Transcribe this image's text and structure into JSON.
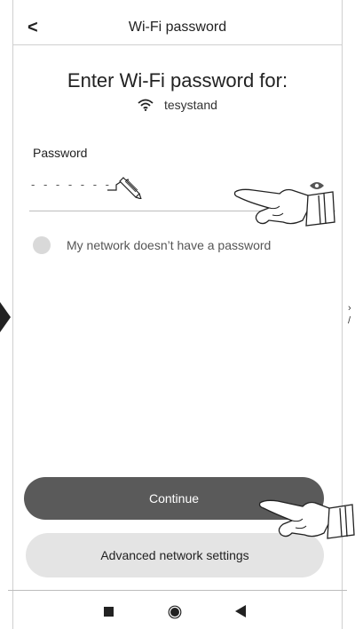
{
  "header": {
    "back_glyph": "<",
    "title": "Wi-Fi password"
  },
  "main": {
    "heading": "Enter Wi-Fi password for:",
    "network_name": "tesystand",
    "password_label": "Password",
    "password_value": "- - - - - - -",
    "no_password_label": "My network doesn’t have a password"
  },
  "buttons": {
    "continue": "Continue",
    "advanced": "Advanced network settings"
  },
  "icons": {
    "wifi": "wifi-icon",
    "eye": "eye-icon",
    "pen": "pen-icon",
    "pointer": "pointing-hand-icon"
  },
  "colors": {
    "primary_button": "#5a5a5a",
    "secondary_button": "#e4e4e4",
    "radio": "#d9d9d9"
  }
}
